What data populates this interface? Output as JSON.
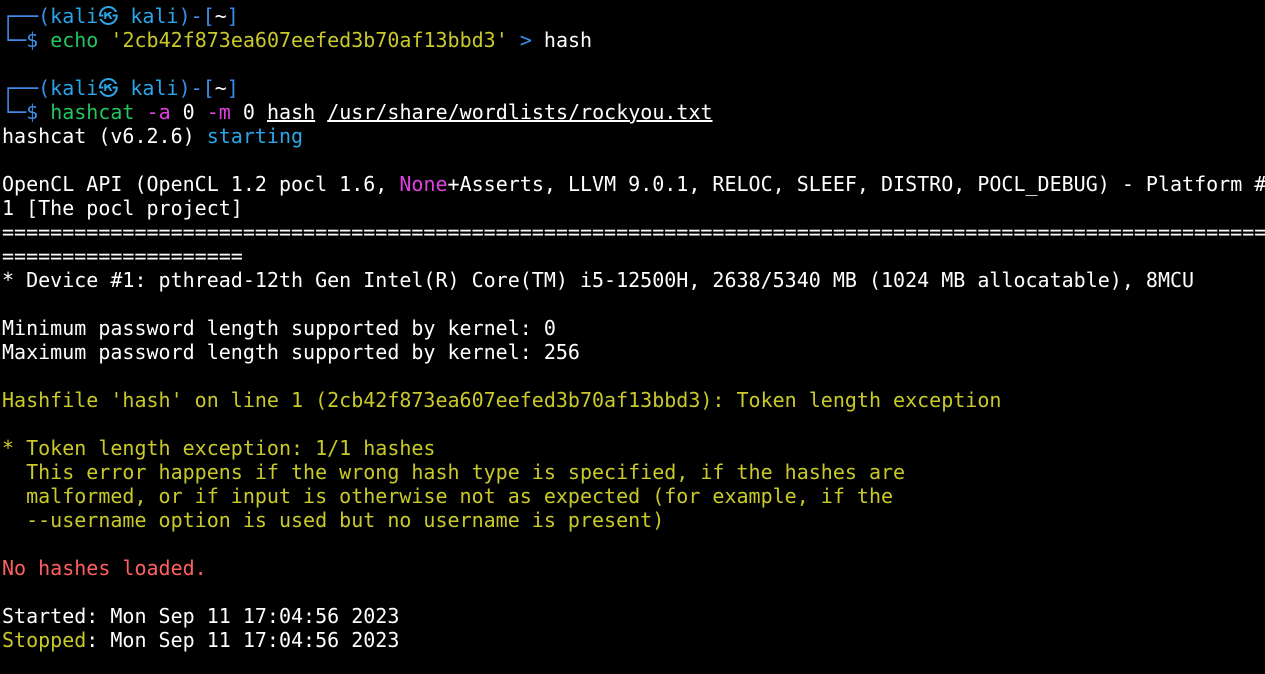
{
  "colors": {
    "background": "#000000",
    "text": "#ffffff",
    "prompt_frame": "#3b8eea",
    "prompt_user": "#2ba5e8",
    "command": "#22c55e",
    "flag": "#e040e0",
    "warning": "#c9c92b",
    "error": "#ff5f5f"
  },
  "prompt": {
    "frame_top": "┌──(",
    "user": "kali",
    "at_symbol": "㉿",
    "host": "kali",
    "close": ")-[",
    "cwd": "~",
    "end": "]",
    "frame_bottom": "└─",
    "dollar": "$ "
  },
  "cmd1": {
    "program": "echo",
    "string": "'2cb42f873ea607eefed3b70af13bbd3'",
    "redirect": ">",
    "target": "hash"
  },
  "cmd2": {
    "program": "hashcat",
    "flag_a": "-a",
    "value_a": "0",
    "flag_m": "-m",
    "value_m": "0",
    "arg_hash": "hash",
    "arg_wordlist": "/usr/share/wordlists/rockyou.txt"
  },
  "output": {
    "version_text": "hashcat (v6.2.6) ",
    "starting": "starting",
    "opencl_pre": "OpenCL API (OpenCL 1.2 pocl 1.6, ",
    "opencl_none": "None",
    "opencl_post": "+Asserts, LLVM 9.0.1, RELOC, SLEEF, DISTRO, POCL_DEBUG) - Platform #",
    "opencl_line2": "1 [The pocl project]",
    "separator_long": "====================================================================================================================",
    "separator_short": "====================",
    "device": "* Device #1: pthread-12th Gen Intel(R) Core(TM) i5-12500H, 2638/5340 MB (1024 MB allocatable), 8MCU",
    "min_pw": "Minimum password length supported by kernel: 0",
    "max_pw": "Maximum password length supported by kernel: 256",
    "hashfile": "Hashfile 'hash' on line 1 (2cb42f873ea607eefed3b70af13bbd3): Token length exception",
    "token_header": "* Token length exception: 1/1 hashes",
    "token_l1": "  This error happens if the wrong hash type is specified, if the hashes are",
    "token_l2": "  malformed, or if input is otherwise not as expected (for example, if the",
    "token_l3": "  --username option is used but no username is present)",
    "no_hashes": "No hashes loaded.",
    "started_label": "Started",
    "started_value": ": Mon Sep 11 17:04:56 2023",
    "stopped_label": "Stopped",
    "stopped_value": ": Mon Sep 11 17:04:56 2023"
  }
}
